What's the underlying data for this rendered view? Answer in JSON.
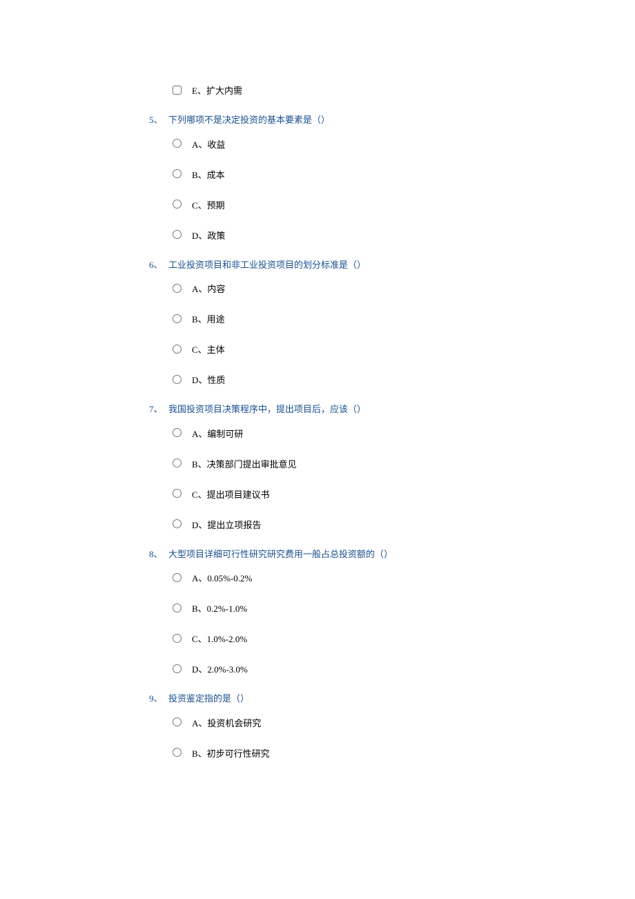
{
  "questions": [
    {
      "number": "",
      "text": "",
      "type": "checkbox",
      "options": [
        {
          "label": "E、扩大内需"
        }
      ]
    },
    {
      "number": "5、",
      "text": "下列哪项不是决定投资的基本要素是（）",
      "type": "radio",
      "options": [
        {
          "label": "A、收益"
        },
        {
          "label": "B、成本"
        },
        {
          "label": "C、预期"
        },
        {
          "label": "D、政策"
        }
      ]
    },
    {
      "number": "6、",
      "text": "工业投资项目和非工业投资项目的划分标准是（）",
      "type": "radio",
      "options": [
        {
          "label": "A、内容"
        },
        {
          "label": "B、用途"
        },
        {
          "label": "C、主体"
        },
        {
          "label": "D、性质"
        }
      ]
    },
    {
      "number": "7、",
      "text": "我国投资项目决策程序中，提出项目后，应该（）",
      "type": "radio",
      "options": [
        {
          "label": "A、编制可研"
        },
        {
          "label": "B、决策部门提出审批意见"
        },
        {
          "label": "C、提出项目建议书"
        },
        {
          "label": "D、提出立项报告"
        }
      ]
    },
    {
      "number": "8、",
      "text": "大型项目详细可行性研究研究费用一般占总投资额的（）",
      "type": "radio",
      "options": [
        {
          "label": "A、0.05%-0.2%"
        },
        {
          "label": "B、0.2%-1.0%"
        },
        {
          "label": "C、1.0%-2.0%"
        },
        {
          "label": "D、2.0%-3.0%"
        }
      ]
    },
    {
      "number": "9、",
      "text": "投资鉴定指的是（）",
      "type": "radio",
      "options": [
        {
          "label": "A、投资机会研究"
        },
        {
          "label": "B、初步可行性研究"
        }
      ]
    }
  ]
}
